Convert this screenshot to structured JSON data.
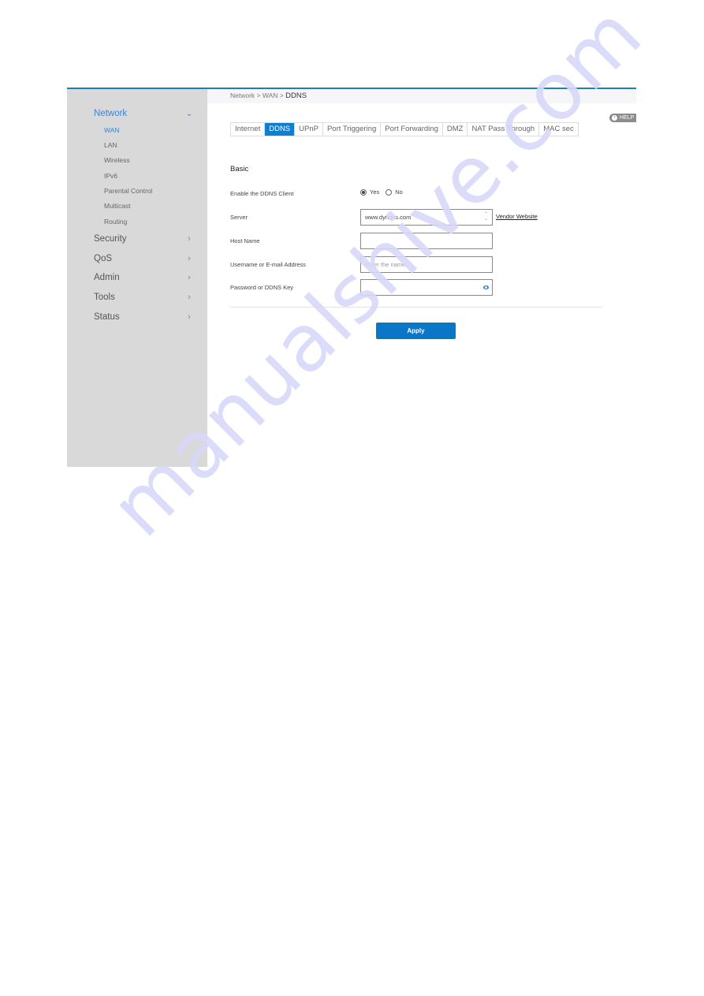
{
  "sidebar": {
    "sections": [
      {
        "label": "Network",
        "expanded": true,
        "active": true
      },
      {
        "label": "Security",
        "expanded": false
      },
      {
        "label": "QoS",
        "expanded": false
      },
      {
        "label": "Admin",
        "expanded": false
      },
      {
        "label": "Tools",
        "expanded": false
      },
      {
        "label": "Status",
        "expanded": false
      }
    ],
    "network_items": [
      {
        "label": "WAN",
        "active": true
      },
      {
        "label": "LAN"
      },
      {
        "label": "Wireless"
      },
      {
        "label": "IPv6"
      },
      {
        "label": "Parental Control"
      },
      {
        "label": "Multicast"
      },
      {
        "label": "Routing"
      }
    ],
    "icons": {
      "expanded": "chevron-down-icon",
      "collapsed": "chevron-right-icon"
    }
  },
  "breadcrumb": {
    "parts": [
      "Network",
      "WAN",
      "DDNS"
    ],
    "separator": ">"
  },
  "help": {
    "label": "HELP",
    "icon": "chevron-left-icon"
  },
  "tabs": [
    {
      "label": "Internet"
    },
    {
      "label": "DDNS",
      "active": true
    },
    {
      "label": "UPnP"
    },
    {
      "label": "Port Triggering"
    },
    {
      "label": "Port Forwarding"
    },
    {
      "label": "DMZ"
    },
    {
      "label": "NAT Pass Through"
    },
    {
      "label": "MAC sec"
    }
  ],
  "form": {
    "section_title": "Basic",
    "enable_ddns": {
      "label": "Enable the DDNS Client",
      "options": [
        "Yes",
        "No"
      ],
      "selected": "Yes"
    },
    "server": {
      "label": "Server",
      "value": "www.dyndns.com",
      "link": "Vendor Website"
    },
    "host_name": {
      "label": "Host Name",
      "value": "",
      "placeholder": ""
    },
    "username": {
      "label": "Username or E-mail Address",
      "value": "",
      "placeholder": "Enter the name"
    },
    "password": {
      "label": "Password or DDNS Key",
      "value": "",
      "icon": "eye-icon"
    },
    "apply_label": "Apply"
  },
  "colors": {
    "accent": "#0f7fd0",
    "sidebar_bg": "#d9d9d9",
    "active_nav": "#3a86d6",
    "top_border": "#1f7fb3",
    "apply_bg": "#0a76c6"
  },
  "watermark": "manualshive.com"
}
